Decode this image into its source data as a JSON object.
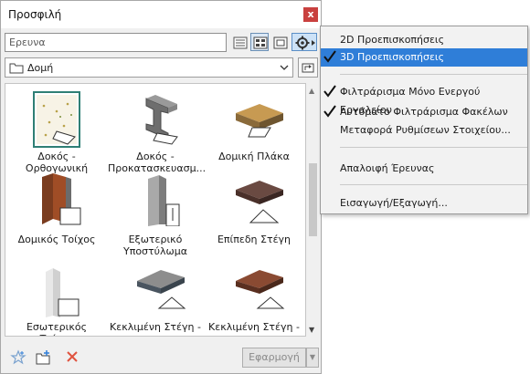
{
  "panel": {
    "title": "Προσφιλή",
    "close_label": "x",
    "search_placeholder": "Ερευνα",
    "folder_label": "Δομή",
    "apply_label": "Εφαρμογή"
  },
  "items": [
    {
      "label1": "Δοκός -",
      "label2": "Ορθογωνική",
      "icon": "rectangular-beam-icon",
      "selected": true
    },
    {
      "label1": "Δοκός -",
      "label2": "Προκατασκευασμ...",
      "icon": "precast-beam-icon",
      "selected": false
    },
    {
      "label1": "Δομική Πλάκα",
      "label2": "",
      "icon": "slab-icon",
      "selected": false
    },
    {
      "label1": "Δομικός Τοίχος",
      "label2": "",
      "icon": "structural-wall-icon",
      "selected": false
    },
    {
      "label1": "Εξωτερικό",
      "label2": "Υποστύλωμα",
      "icon": "exterior-column-icon",
      "selected": false
    },
    {
      "label1": "Επίπεδη Στέγη",
      "label2": "",
      "icon": "flat-roof-icon",
      "selected": false
    },
    {
      "label1": "Εσωτερικός Τοίχος",
      "label2": "",
      "icon": "interior-wall-icon",
      "selected": false
    },
    {
      "label1": "Κεκλιμένη Στέγη -",
      "label2": "",
      "icon": "pitched-roof-icon",
      "selected": false
    },
    {
      "label1": "Κεκλιμένη Στέγη -",
      "label2": "",
      "icon": "pitched-roof-wood-icon",
      "selected": false
    }
  ],
  "menu": {
    "preview_2d": "2D Προεπισκοπήσεις",
    "preview_3d": "3D Προεπισκοπήσεις",
    "filter_active_tool": "Φιλτράρισμα Μόνο Ενεργού Εργαλείου",
    "auto_filter_folders": "Αυτόματο Φιλτράρισμα Φακέλων",
    "transfer_settings": "Μεταφορά Ρυθμίσεων Στοιχείου...",
    "clear_search": "Απαλοιφή Έρευνας",
    "import_export": "Εισαγωγή/Εξαγωγή..."
  },
  "colors": {
    "menu_highlight": "#2f7ed8",
    "close_red": "#c9413f",
    "selection_teal": "#2f7f75",
    "delete_red": "#e0533f"
  }
}
